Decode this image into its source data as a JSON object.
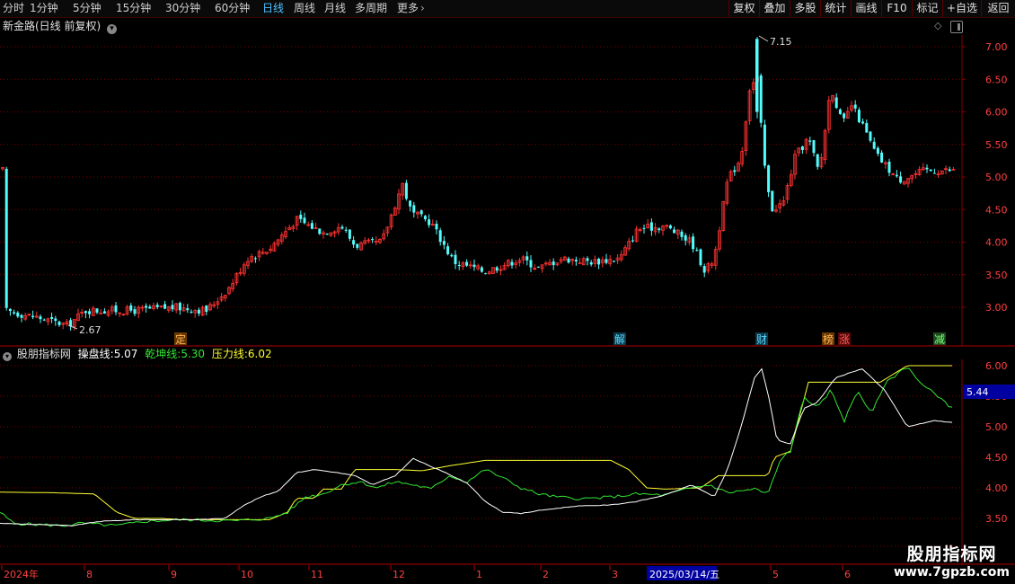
{
  "toolbar": {
    "timeframes": [
      {
        "label": "分时",
        "active": false
      },
      {
        "label": "1分钟",
        "active": false
      },
      {
        "label": "5分钟",
        "active": false
      },
      {
        "label": "15分钟",
        "active": false
      },
      {
        "label": "30分钟",
        "active": false
      },
      {
        "label": "60分钟",
        "active": false
      },
      {
        "label": "日线",
        "active": true
      },
      {
        "label": "周线",
        "active": false
      },
      {
        "label": "月线",
        "active": false
      },
      {
        "label": "多周期",
        "active": false
      },
      {
        "label": "更多",
        "active": false
      }
    ],
    "more_arrow": "›",
    "right_buttons": [
      "复权",
      "叠加",
      "多股",
      "统计",
      "画线",
      "F10",
      "标记",
      "+自选",
      "返回"
    ]
  },
  "main_panel": {
    "title": "新金路(日线 前复权)",
    "y_ticks": [
      "7.00",
      "6.50",
      "6.00",
      "5.50",
      "5.00",
      "4.50",
      "4.00",
      "3.50",
      "3.00"
    ],
    "high_label": "7.15",
    "low_label": "2.67",
    "event_tags": [
      "定",
      "解",
      "财",
      "榜",
      "涨",
      "减"
    ],
    "colors": {
      "up": "#ff3232",
      "down": "#54fcfc"
    }
  },
  "sub_panel": {
    "indicator_name": "股朋指标网",
    "lines": [
      {
        "label": "操盘线:",
        "value": "5.07",
        "color": "#ffffff"
      },
      {
        "label": "乾坤线:",
        "value": "5.30",
        "color": "#33e633"
      },
      {
        "label": "压力线:",
        "value": "6.02",
        "color": "#ffff33"
      }
    ],
    "y_ticks": [
      "6.00",
      "5.50",
      "5.00",
      "4.50",
      "4.00",
      "3.50"
    ],
    "current_value_badge": "5.44"
  },
  "x_axis": {
    "labels": [
      "2024年",
      "8",
      "9",
      "10",
      "11",
      "12",
      "1",
      "2",
      "3",
      "2025/03/14/五",
      "5",
      "6"
    ]
  },
  "watermark": {
    "title": "股朋指标网",
    "url": "www.7gpzb.com"
  }
}
